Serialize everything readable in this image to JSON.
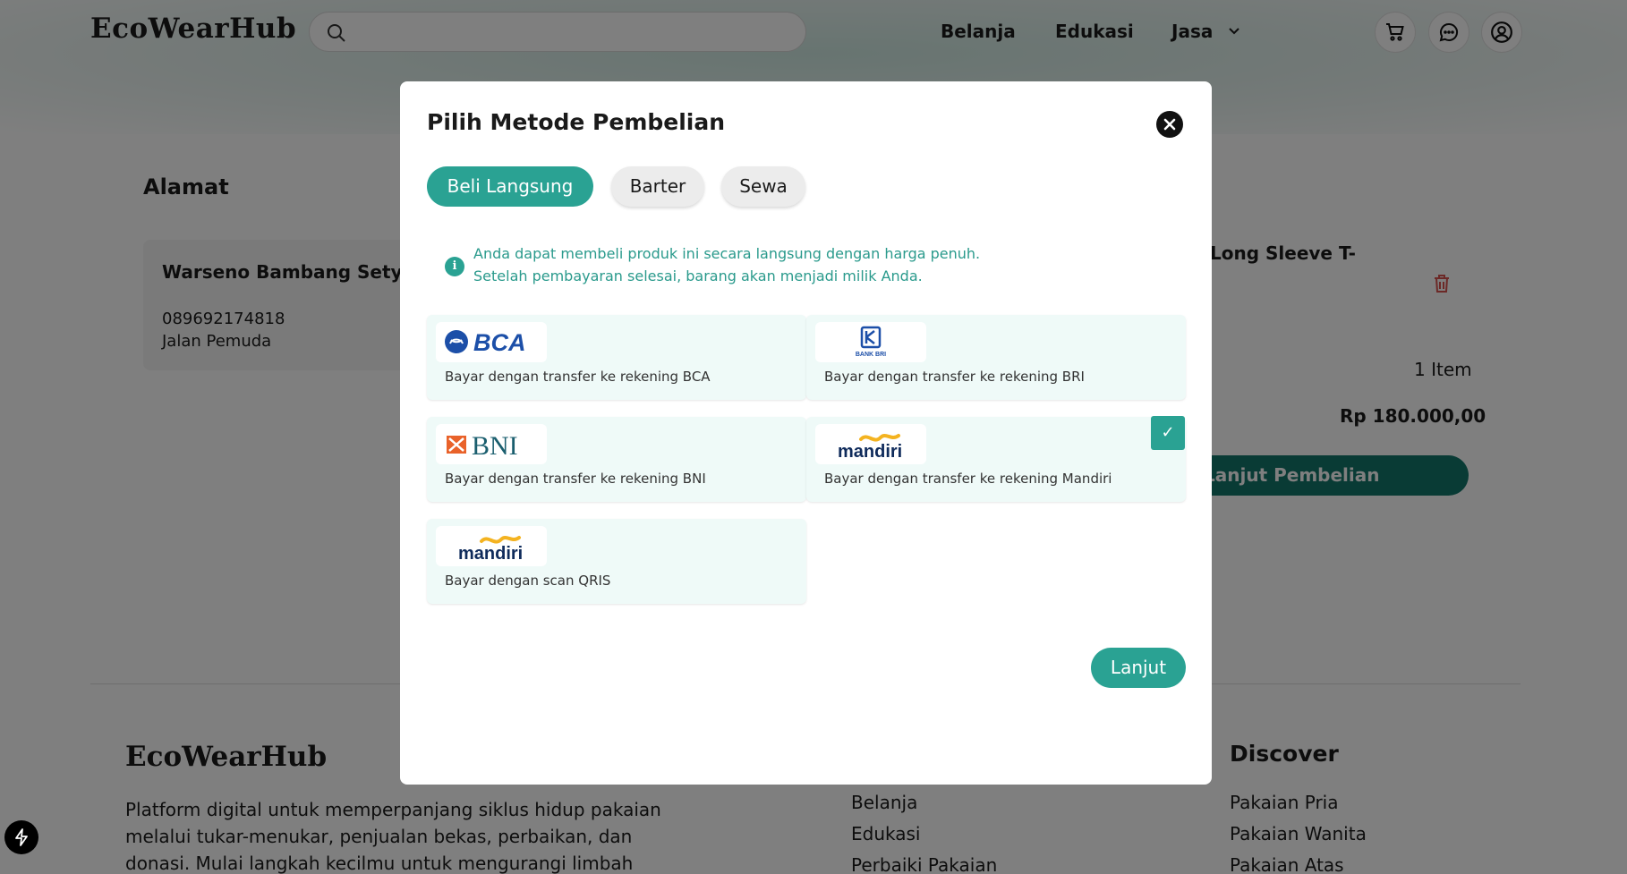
{
  "header": {
    "logo": "EcoWearHub",
    "search_placeholder": "",
    "nav": [
      {
        "label": "Belanja"
      },
      {
        "label": "Edukasi"
      },
      {
        "label": "Jasa"
      }
    ]
  },
  "checkout": {
    "alamat_title": "Alamat",
    "address": {
      "name": "Warseno Bambang Setyono",
      "phone": "089692174818",
      "street": "Jalan Pemuda"
    },
    "product_title": "Long Sleeve T-",
    "item_count": "1 Item",
    "total": "Rp 180.000,00",
    "checkout_button": "Lanjut Pembelian"
  },
  "footer": {
    "logo": "EcoWearHub",
    "description": "Platform digital untuk memperpanjang siklus hidup pakaian melalui tukar-menukar, penjualan bekas, perbaikan, dan donasi. Mulai langkah kecilmu untuk mengurangi limbah",
    "links": [
      "Belanja",
      "Edukasi",
      "Perbaiki Pakaian"
    ],
    "discover_title": "Discover",
    "discover_links": [
      "Pakaian Pria",
      "Pakaian Wanita",
      "Pakaian Atas"
    ]
  },
  "modal": {
    "title": "Pilih Metode Pembelian",
    "tabs": [
      {
        "label": "Beli Langsung",
        "active": true
      },
      {
        "label": "Barter",
        "active": false
      },
      {
        "label": "Sewa",
        "active": false
      }
    ],
    "info_lines": [
      "Anda dapat membeli produk ini secara langsung dengan harga penuh.",
      "Setelah pembayaran selesai, barang akan menjadi milik Anda."
    ],
    "methods": [
      {
        "logo_text": "BCA",
        "label": "Bayar dengan transfer ke rekening BCA",
        "selected": false
      },
      {
        "logo_text": "BANK BRI",
        "label": "Bayar dengan transfer ke rekening BRI",
        "selected": false
      },
      {
        "logo_text": "BNI",
        "label": "Bayar dengan transfer ke rekening BNI",
        "selected": false
      },
      {
        "logo_text": "mandiri",
        "label": "Bayar dengan transfer ke rekening Mandiri",
        "selected": true
      },
      {
        "logo_text": "mandiri",
        "label": "Bayar dengan scan QRIS",
        "selected": false
      }
    ],
    "check_glyph": "✓",
    "continue_button": "Lanjut"
  },
  "colors": {
    "accent": "#2aa293",
    "accent_dark": "#13766a",
    "bca_blue": "#1c4fa8",
    "bni_orange": "#e9622a",
    "bni_teal": "#1a5e6e",
    "mandiri_navy": "#0f2b5b",
    "mandiri_gold": "#f4b320"
  },
  "icons": [
    "search-icon",
    "chevron-down-icon",
    "cart-icon",
    "chat-icon",
    "user-icon",
    "trash-icon",
    "info-icon",
    "close-icon",
    "check-icon",
    "bolt-icon"
  ]
}
